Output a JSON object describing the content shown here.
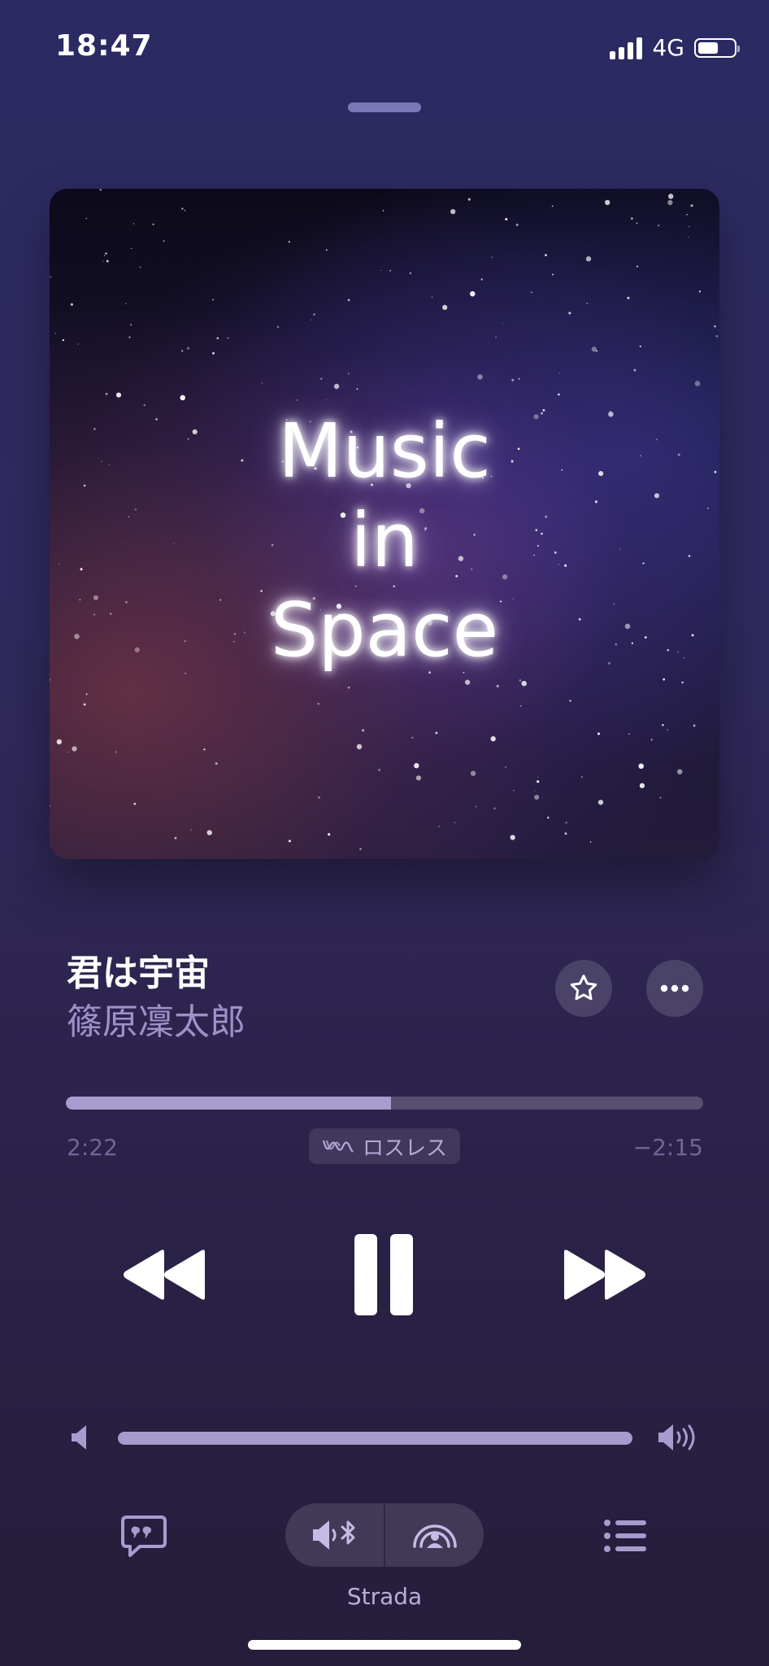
{
  "status_bar": {
    "time": "18:47",
    "network": "4G",
    "signal_bars": 4,
    "battery_level": 0.55
  },
  "album_art": {
    "title_lines": [
      "Music",
      "in",
      "Space"
    ]
  },
  "track": {
    "title": "君は宇宙",
    "artist": "篠原凜太郎"
  },
  "actions": {
    "favorite_icon": "star-icon",
    "more_icon": "more-icon"
  },
  "progress": {
    "elapsed": "2:22",
    "remaining": "−2:15",
    "fraction": 0.51,
    "badge_label": "ロスレス"
  },
  "transport": {
    "rewind_icon": "rewind-icon",
    "pause_icon": "pause-icon",
    "forward_icon": "fast-forward-icon"
  },
  "volume": {
    "level": 1.0
  },
  "bottom_bar": {
    "lyrics_icon": "lyrics-icon",
    "speaker_icon": "speaker-bluetooth-icon",
    "airplay_icon": "airplay-audio-icon",
    "queue_icon": "queue-list-icon",
    "device_name": "Strada"
  },
  "colors": {
    "accent": "#a79ccd",
    "artist_text": "#9d91c8",
    "muted_text": "#6f6598"
  }
}
